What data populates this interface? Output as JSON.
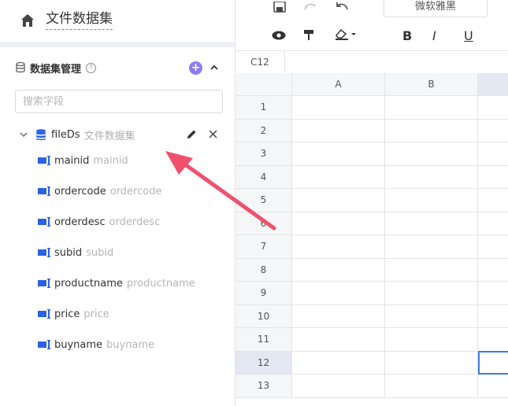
{
  "header": {
    "title": "文件数据集"
  },
  "dataset_panel": {
    "label": "数据集管理",
    "help": "?",
    "add": "+",
    "search_placeholder": "搜索字段",
    "dataset": {
      "name": "fileDs",
      "alias": "文件数据集"
    },
    "fields": [
      {
        "name": "mainid",
        "alias": "mainid"
      },
      {
        "name": "ordercode",
        "alias": "ordercode"
      },
      {
        "name": "orderdesc",
        "alias": "orderdesc"
      },
      {
        "name": "subid",
        "alias": "subid"
      },
      {
        "name": "productname",
        "alias": "productname"
      },
      {
        "name": "price",
        "alias": "price"
      },
      {
        "name": "buyname",
        "alias": "buyname"
      }
    ]
  },
  "toolbar": {
    "font": "微软雅黑",
    "bold": "B",
    "italic": "I",
    "underline": "U"
  },
  "formula_bar": {
    "cell_ref": "C12"
  },
  "sheet": {
    "columns": [
      "A",
      "B"
    ],
    "rows": [
      "1",
      "2",
      "3",
      "4",
      "5",
      "6",
      "7",
      "8",
      "9",
      "10",
      "11",
      "12",
      "13"
    ],
    "selected_row": "12"
  },
  "colors": {
    "accent": "#8b7cf6",
    "field_icon": "#2b62e0",
    "selection": "#3b7ce6",
    "arrow": "#f0506e"
  }
}
